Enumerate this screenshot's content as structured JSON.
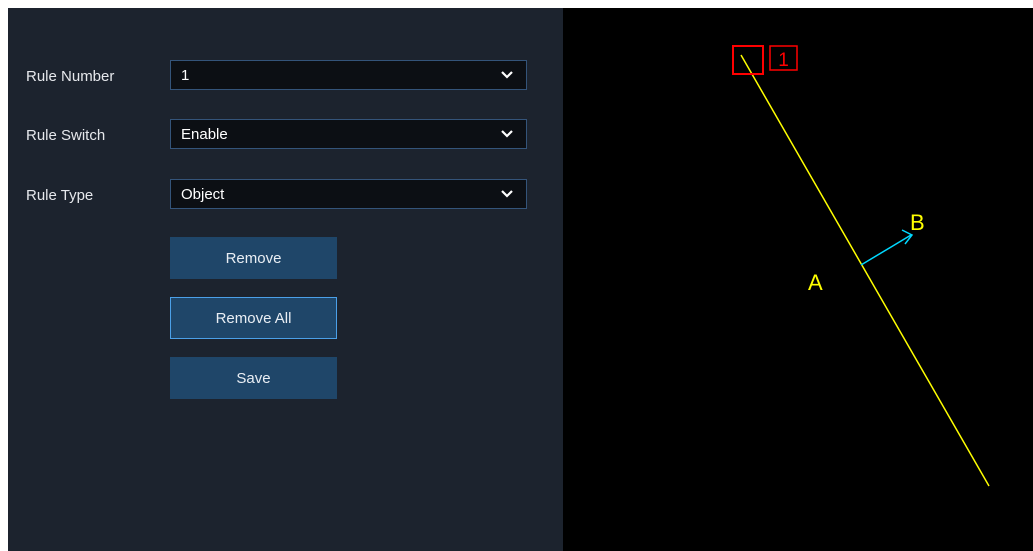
{
  "form": {
    "rule_number": {
      "label": "Rule Number",
      "value": "1"
    },
    "rule_switch": {
      "label": "Rule Switch",
      "value": "Enable"
    },
    "rule_type": {
      "label": "Rule Type",
      "value": "Object"
    }
  },
  "buttons": {
    "remove": "Remove",
    "remove_all": "Remove All",
    "save": "Save"
  },
  "canvas": {
    "rule_id": "1",
    "point_a": "A",
    "point_b": "B",
    "colors": {
      "line": "#ffff00",
      "marker": "#ff0000",
      "arrow": "#00d8ff",
      "labels": "#ffff00"
    }
  },
  "icons": [
    "chevron-down-icon",
    "handle-square-icon",
    "direction-arrow-icon"
  ]
}
